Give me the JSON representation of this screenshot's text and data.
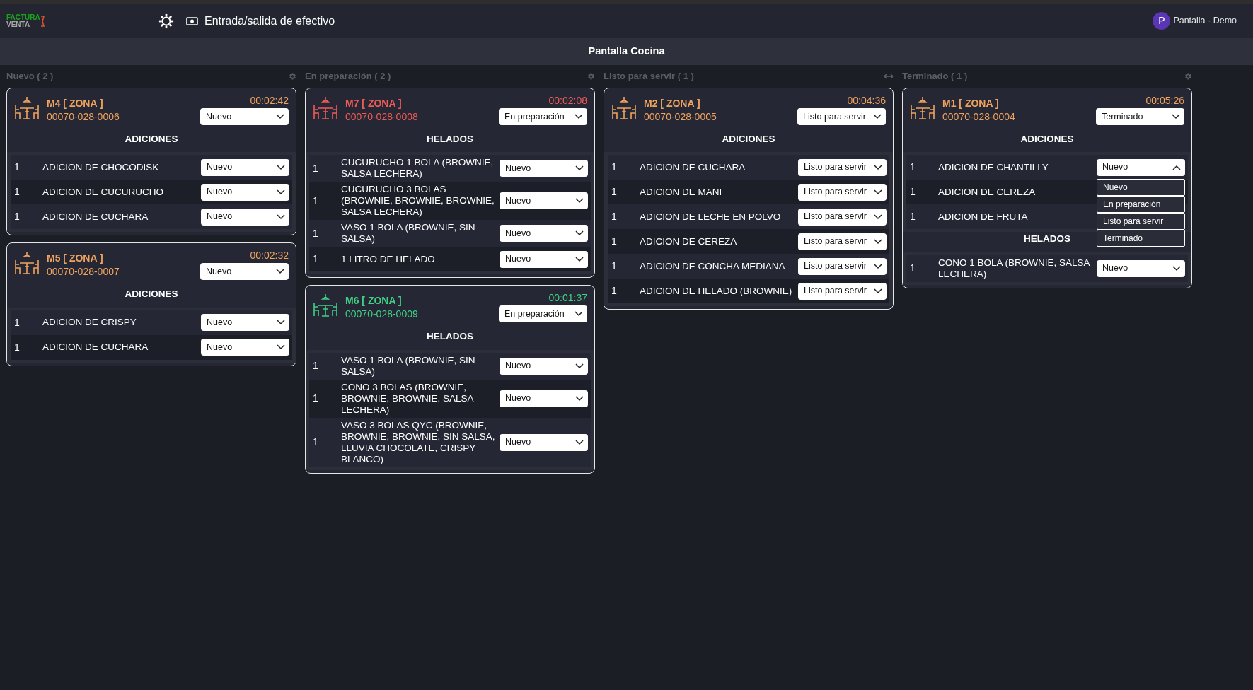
{
  "logo": {
    "line1": "FACTURA",
    "line2": "VENTA"
  },
  "nav": {
    "cash_label": "Entrada/salida de efectivo"
  },
  "user": {
    "initial": "P",
    "name": "Pantalla - Demo"
  },
  "page_title": "Pantalla Cocina",
  "columns": [
    {
      "title": "Nuevo ( 2 )",
      "kind": "gear",
      "cards": [
        {
          "table": "M4 [ ZONA ]",
          "order": "00070-028-0006",
          "timer": "00:02:42",
          "color": "#f0a35e",
          "status": "Nuevo",
          "sections": [
            {
              "title": "ADICIONES",
              "items": [
                {
                  "qty": "1",
                  "name": "ADICION DE CHOCODISK",
                  "status": "Nuevo",
                  "expanded": false
                },
                {
                  "qty": "1",
                  "name": "ADICION DE CUCURUCHO",
                  "status": "Nuevo",
                  "expanded": false
                },
                {
                  "qty": "1",
                  "name": "ADICION DE CUCHARA",
                  "status": "Nuevo",
                  "expanded": false
                }
              ]
            }
          ]
        },
        {
          "table": "M5 [ ZONA ]",
          "order": "00070-028-0007",
          "timer": "00:02:32",
          "color": "#f0a35e",
          "status": "Nuevo",
          "sections": [
            {
              "title": "ADICIONES",
              "items": [
                {
                  "qty": "1",
                  "name": "ADICION DE CRISPY",
                  "status": "Nuevo",
                  "expanded": false
                },
                {
                  "qty": "1",
                  "name": "ADICION DE CUCHARA",
                  "status": "Nuevo",
                  "expanded": false
                }
              ]
            }
          ]
        }
      ]
    },
    {
      "title": "En preparación ( 2 )",
      "kind": "gear",
      "cards": [
        {
          "table": "M7 [ ZONA ]",
          "order": "00070-028-0008",
          "timer": "00:02:08",
          "color": "#ef5b57",
          "status": "En preparación",
          "sections": [
            {
              "title": "HELADOS",
              "items": [
                {
                  "qty": "1",
                  "name": "CUCURUCHO 1 BOLA (BROWNIE, SALSA LECHERA)",
                  "status": "Nuevo",
                  "expanded": false
                },
                {
                  "qty": "1",
                  "name": "CUCURUCHO 3 BOLAS (BROWNIE, BROWNIE, BROWNIE, SALSA LECHERA)",
                  "status": "Nuevo",
                  "expanded": false
                },
                {
                  "qty": "1",
                  "name": "VASO 1 BOLA (BROWNIE, SIN SALSA)",
                  "status": "Nuevo",
                  "expanded": false
                },
                {
                  "qty": "1",
                  "name": "1 LITRO DE HELADO",
                  "status": "Nuevo",
                  "expanded": false
                }
              ]
            }
          ]
        },
        {
          "table": "M6 [ ZONA ]",
          "order": "00070-028-0009",
          "timer": "00:01:37",
          "color": "#3fd184",
          "status": "En preparación",
          "sections": [
            {
              "title": "HELADOS",
              "items": [
                {
                  "qty": "1",
                  "name": "VASO 1 BOLA (BROWNIE, SIN SALSA)",
                  "status": "Nuevo",
                  "expanded": false
                },
                {
                  "qty": "1",
                  "name": "CONO 3 BOLAS (BROWNIE, BROWNIE, BROWNIE, SALSA LECHERA)",
                  "status": "Nuevo",
                  "expanded": false
                },
                {
                  "qty": "1",
                  "name": "VASO 3 BOLAS QYC (BROWNIE, BROWNIE, BROWNIE, SIN SALSA, LLUVIA CHOCOLATE, CRISPY BLANCO)",
                  "status": "Nuevo",
                  "expanded": false
                }
              ]
            }
          ]
        }
      ]
    },
    {
      "title": "Listo para servir ( 1 )",
      "kind": "arrows",
      "cards": [
        {
          "table": "M2 [ ZONA ]",
          "order": "00070-028-0005",
          "timer": "00:04:36",
          "color": "#f0a35e",
          "status": "Listo para servir",
          "sections": [
            {
              "title": "ADICIONES",
              "items": [
                {
                  "qty": "1",
                  "name": "ADICION DE CUCHARA",
                  "status": "Listo para servir",
                  "expanded": false
                },
                {
                  "qty": "1",
                  "name": "ADICION DE MANI",
                  "status": "Listo para servir",
                  "expanded": false
                },
                {
                  "qty": "1",
                  "name": "ADICION DE LECHE EN POLVO",
                  "status": "Listo para servir",
                  "expanded": false
                },
                {
                  "qty": "1",
                  "name": "ADICION DE CEREZA",
                  "status": "Listo para servir",
                  "expanded": false
                },
                {
                  "qty": "1",
                  "name": "ADICION DE CONCHA MEDIANA",
                  "status": "Listo para servir",
                  "expanded": false
                },
                {
                  "qty": "1",
                  "name": "ADICION DE HELADO (BROWNIE)",
                  "status": "Listo para servir",
                  "expanded": false
                }
              ]
            }
          ]
        }
      ]
    },
    {
      "title": "Terminado ( 1 )",
      "kind": "gear",
      "cards": [
        {
          "table": "M1 [ ZONA ]",
          "order": "00070-028-0004",
          "timer": "00:05:26",
          "color": "#f0a35e",
          "status": "Terminado",
          "sections": [
            {
              "title": "ADICIONES",
              "items": [
                {
                  "qty": "1",
                  "name": "ADICION DE CHANTILLY",
                  "status": "Nuevo",
                  "expanded": true,
                  "options": [
                    {
                      "label": "Nuevo",
                      "selected": false
                    },
                    {
                      "label": "En preparación",
                      "selected": false
                    },
                    {
                      "label": "Listo para servir",
                      "selected": false
                    },
                    {
                      "label": "Terminado",
                      "selected": false
                    }
                  ]
                },
                {
                  "qty": "1",
                  "name": "ADICION DE CEREZA"
                },
                {
                  "qty": "1",
                  "name": "ADICION DE FRUTA"
                }
              ]
            },
            {
              "title": "HELADOS",
              "items": [
                {
                  "qty": "1",
                  "name": "CONO 1 BOLA (BROWNIE, SALSA LECHERA)",
                  "status": "Nuevo",
                  "expanded": false
                }
              ]
            }
          ]
        }
      ]
    }
  ]
}
